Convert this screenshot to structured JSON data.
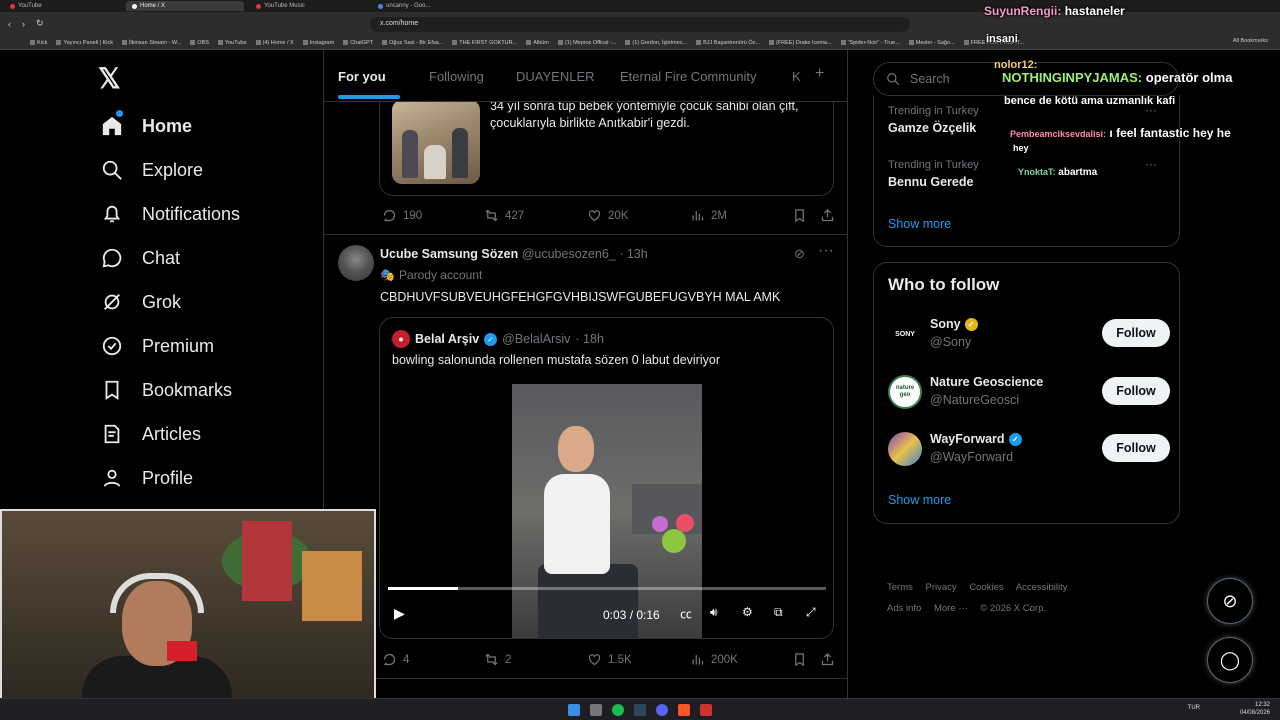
{
  "browser": {
    "tabs": [
      {
        "label": "YouTube",
        "active": false
      },
      {
        "label": "Home / X",
        "active": true
      },
      {
        "label": "YouTube Music",
        "active": false
      },
      {
        "label": "uncanny - Goo...",
        "active": false
      }
    ],
    "url": "x.com/home",
    "bookmarks": [
      "Kick",
      "Yayıncı Paneli | Kick",
      "İlkinsan Stream - W...",
      "OBS",
      "YouTube",
      "(4) Home / X",
      "Instagram",
      "ChatGPT",
      "Oğuz Sasi - Bir Efsa...",
      "THE FIRST GOKTUR...",
      "Albüm",
      "(1) Meproz Offical -...",
      "(1) Gordon, İşletmec...",
      "BJJ Başantrenörü Öz...",
      "(FREE) Drake Icema...",
      "\"Spider-Noir\" - True...",
      "Mesler - Sağo...",
      "FREE FOR PROFIT..."
    ],
    "all_bookmarks": "All Bookmarks"
  },
  "sidebar": {
    "items": [
      {
        "label": "Home",
        "icon": "home-icon"
      },
      {
        "label": "Explore",
        "icon": "search-icon"
      },
      {
        "label": "Notifications",
        "icon": "bell-icon"
      },
      {
        "label": "Chat",
        "icon": "chat-icon"
      },
      {
        "label": "Grok",
        "icon": "grok-icon"
      },
      {
        "label": "Premium",
        "icon": "premium-icon"
      },
      {
        "label": "Bookmarks",
        "icon": "bookmark-icon"
      },
      {
        "label": "Articles",
        "icon": "articles-icon"
      },
      {
        "label": "Profile",
        "icon": "profile-icon"
      }
    ]
  },
  "feed": {
    "tabs": [
      "For you",
      "Following",
      "DUAYENLER",
      "Eternal Fire Community",
      "K"
    ],
    "prev_quote_text": "34 yıl sonra tüp bebek yöntemiyle çocuk sahibi olan çift, çocuklarıyla birlikte Anıtkabir'i gezdi.",
    "prev_actions": {
      "replies": "190",
      "reposts": "427",
      "likes": "20K",
      "views": "2M"
    },
    "tweet": {
      "name": "Ucube Samsung Sözen",
      "handle": "@ucubesozen6_",
      "time": "· 13h",
      "badge": "Parody account",
      "text": "CBDHUVFSUBVEUHGFEHGFGVHBIJSWFGUBEFUGVBYH MAL AMK",
      "quote": {
        "name": "Belal Arşiv",
        "handle": "@BelalArsiv",
        "time": "· 18h",
        "text": "bowling salonunda rollenen mustafa sözen 0 labut deviriyor",
        "video_time": "0:03 / 0:16",
        "progress": 0.16
      },
      "actions": {
        "replies": "4",
        "reposts": "2",
        "likes": "1.5K",
        "views": "200K"
      }
    }
  },
  "right": {
    "search_placeholder": "Search",
    "trends": [
      {
        "context": "Trending in Turkey",
        "name": "Gamze Özçelik"
      },
      {
        "context": "Trending in Turkey",
        "name": "Bennu Gerede"
      }
    ],
    "show_more": "Show more",
    "who_title": "Who to follow",
    "follows": [
      {
        "name": "Sony",
        "handle": "@Sony",
        "badge": "gold",
        "avatar_text": "SONY"
      },
      {
        "name": "Nature Geoscience",
        "handle": "@NatureGeosci",
        "badge": "",
        "avatar_text": "nature geo"
      },
      {
        "name": "WayForward",
        "handle": "@WayForward",
        "badge": "blue",
        "avatar_text": ""
      }
    ],
    "follow_label": "Follow",
    "footer": [
      "Terms",
      "Privacy",
      "Cookies",
      "Accessibility",
      "Ads info",
      "More ···",
      "© 2026 X Corp."
    ]
  },
  "overlay_chat": [
    {
      "user": "SuyunRengii:",
      "msg": "hastaneler"
    },
    {
      "user": "",
      "msg": "insani"
    },
    {
      "user": "nolor12:",
      "msg": ""
    },
    {
      "user": "NOTHINGINPYJAMAS:",
      "msg": "operatör olma"
    },
    {
      "user": "",
      "msg": "bence de kötü ama uzmanlık kafi"
    },
    {
      "user": "Pembeamciksevdalisi:",
      "msg": "ı feel fantastic hey he"
    },
    {
      "user": "",
      "msg": "hey"
    },
    {
      "user": "YnoktaT:",
      "msg": "abartma"
    }
  ],
  "taskbar": {
    "lang": "TUR",
    "time": "12:32",
    "date": "04/08/2026"
  },
  "colors": {
    "accent": "#1d9bf0",
    "bg": "#000000",
    "border": "#2f3336",
    "muted": "#71767b"
  }
}
